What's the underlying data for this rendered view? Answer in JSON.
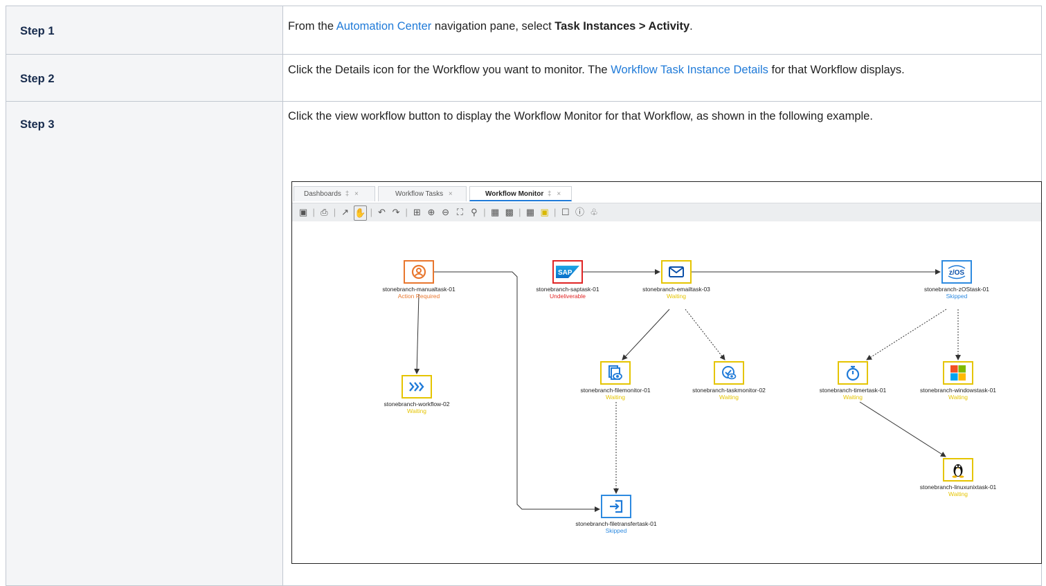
{
  "steps": [
    {
      "label": "Step 1",
      "text": {
        "pre": "From the ",
        "link": "Automation Center",
        "mid": " navigation pane, select ",
        "bold": "Task Instances > Activity",
        "post": "."
      }
    },
    {
      "label": "Step 2",
      "text": {
        "pre": "Click the Details icon for the Workflow you want to monitor. The ",
        "link": "Workflow Task Instance Details",
        "post": " for that Workflow displays."
      }
    },
    {
      "label": "Step 3",
      "text": {
        "full": "Click the view workflow button to display the Workflow Monitor for that Workflow, as shown in the following example."
      }
    }
  ],
  "screenshot": {
    "tabs": [
      {
        "label": "Dashboards",
        "pin": "‡",
        "close": "×",
        "active": false
      },
      {
        "label": "Workflow Tasks",
        "close": "×",
        "active": false
      },
      {
        "label": "Workflow Monitor",
        "pin": "‡",
        "close": "×",
        "active": true
      }
    ],
    "toolbar_icons": [
      "overview-icon",
      "print-icon",
      "arrow-icon",
      "hand-pan-icon",
      "undo-icon",
      "redo-icon",
      "fit-icon",
      "zoom-in-icon",
      "zoom-out-icon",
      "fullscreen-icon",
      "search-icon",
      "layout-horizontal-icon",
      "layout-vertical-icon",
      "layout-icon",
      "highlight-icon",
      "monitor-icon",
      "help-icon",
      "bell-icon"
    ],
    "nodes": [
      {
        "id": "manual",
        "name": "stonebranch-manualtask-01",
        "status": "Action Required",
        "status_color": "#e8762d",
        "border": "#e8762d",
        "icon": "user-circle-icon"
      },
      {
        "id": "sap",
        "name": "stonebranch-saptask-01",
        "status": "Undeliverable",
        "status_color": "#e02424",
        "border": "#e02424",
        "icon": "sap-logo-icon",
        "icon_text": "SAP"
      },
      {
        "id": "email",
        "name": "stonebranch-emailtask-03",
        "status": "Waiting",
        "status_color": "#e5c400",
        "border": "#e5c400",
        "icon": "envelope-icon"
      },
      {
        "id": "zos",
        "name": "stonebranch-zOStask-01",
        "status": "Skipped",
        "status_color": "#2d8ae0",
        "border": "#2d8ae0",
        "icon": "zos-icon",
        "icon_text": "z/OS"
      },
      {
        "id": "workflow",
        "name": "stonebranch-workflow-02",
        "status": "Waiting",
        "status_color": "#e5c400",
        "border": "#e5c400",
        "icon": "workflow-chevrons-icon"
      },
      {
        "id": "filemon",
        "name": "stonebranch-filemonitor-01",
        "status": "Waiting",
        "status_color": "#e5c400",
        "border": "#e5c400",
        "icon": "file-monitor-icon"
      },
      {
        "id": "taskmon",
        "name": "stonebranch-taskmonitor-02",
        "status": "Waiting",
        "status_color": "#e5c400",
        "border": "#e5c400",
        "icon": "task-monitor-icon"
      },
      {
        "id": "timer",
        "name": "stonebranch-timertask-01",
        "status": "Waiting",
        "status_color": "#e5c400",
        "border": "#e5c400",
        "icon": "stopwatch-icon"
      },
      {
        "id": "windows",
        "name": "stonebranch-windowstask-01",
        "status": "Waiting",
        "status_color": "#e5c400",
        "border": "#e5c400",
        "icon": "windows-logo-icon"
      },
      {
        "id": "linux",
        "name": "stonebranch-linuxunixtask-01",
        "status": "Waiting",
        "status_color": "#e5c400",
        "border": "#e5c400",
        "icon": "linux-penguin-icon"
      },
      {
        "id": "ftp",
        "name": "stonebranch-filetransfertask-01",
        "status": "Skipped",
        "status_color": "#2d8ae0",
        "border": "#2d8ae0",
        "icon": "file-transfer-icon"
      }
    ],
    "edges": [
      {
        "from": "manual",
        "to": "workflow",
        "style": "solid"
      },
      {
        "from": "manual",
        "to": "ftp",
        "style": "solid"
      },
      {
        "from": "sap",
        "to": "email",
        "style": "solid"
      },
      {
        "from": "email",
        "to": "zos",
        "style": "solid"
      },
      {
        "from": "email",
        "to": "filemon",
        "style": "solid"
      },
      {
        "from": "email",
        "to": "taskmon",
        "style": "dashed"
      },
      {
        "from": "zos",
        "to": "timer",
        "style": "dashed"
      },
      {
        "from": "zos",
        "to": "windows",
        "style": "dashed"
      },
      {
        "from": "timer",
        "to": "linux",
        "style": "solid"
      },
      {
        "from": "filemon",
        "to": "ftp",
        "style": "dashed"
      }
    ]
  }
}
